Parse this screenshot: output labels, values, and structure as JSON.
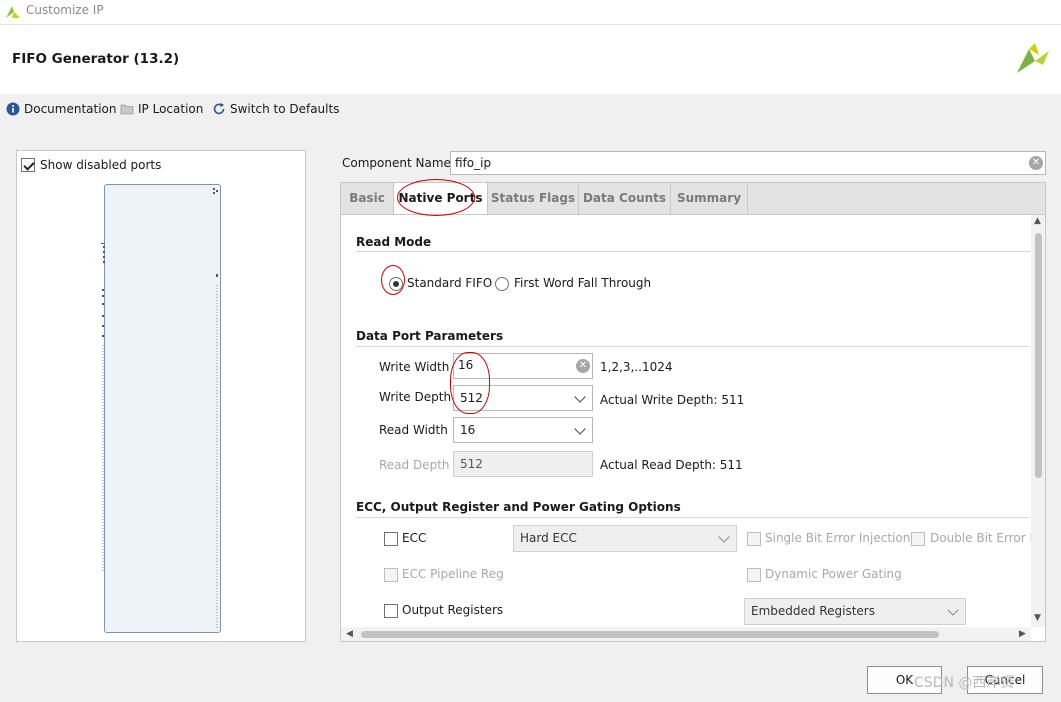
{
  "window": {
    "title": "Customize IP"
  },
  "header": {
    "ip_name": "FIFO Generator (13.2)"
  },
  "toolbar": {
    "documentation": "Documentation",
    "ip_location": "IP Location",
    "switch_defaults": "Switch to Defaults"
  },
  "left_panel": {
    "show_disabled_ports_label": "Show disabled ports",
    "show_disabled_ports_checked": true
  },
  "component": {
    "label": "Component Name",
    "value": "fifo_ip"
  },
  "tabs": [
    {
      "label": "Basic",
      "active": false
    },
    {
      "label": "Native Ports",
      "active": true
    },
    {
      "label": "Status Flags",
      "active": false
    },
    {
      "label": "Data Counts",
      "active": false
    },
    {
      "label": "Summary",
      "active": false
    }
  ],
  "read_mode": {
    "title": "Read Mode",
    "standard": "Standard FIFO",
    "fwft": "First Word Fall Through",
    "selected": "standard"
  },
  "data_port": {
    "title": "Data Port Parameters",
    "write_width_label": "Write Width",
    "write_width_value": "16",
    "write_width_range": "1,2,3,..1024",
    "write_depth_label": "Write Depth",
    "write_depth_value": "512",
    "actual_write_depth": "Actual Write Depth: 511",
    "read_width_label": "Read Width",
    "read_width_value": "16",
    "read_depth_label": "Read Depth",
    "read_depth_value": "512",
    "actual_read_depth": "Actual Read Depth: 511"
  },
  "ecc": {
    "title": "ECC, Output Register and Power Gating Options",
    "ecc_label": "ECC",
    "ecc_type": "Hard ECC",
    "single_bit": "Single Bit Error Injection",
    "double_bit": "Double Bit Error In",
    "ecc_pipeline": "ECC Pipeline Reg",
    "dynamic_power": "Dynamic Power Gating",
    "output_registers": "Output Registers",
    "register_type": "Embedded Registers"
  },
  "buttons": {
    "ok": "OK",
    "cancel": "Cancel"
  },
  "watermark": "CSDN @西岸贤",
  "colors": {
    "brand_green": "#8cc63f",
    "annotation_red": "#d00000",
    "info_blue": "#2b5797"
  }
}
